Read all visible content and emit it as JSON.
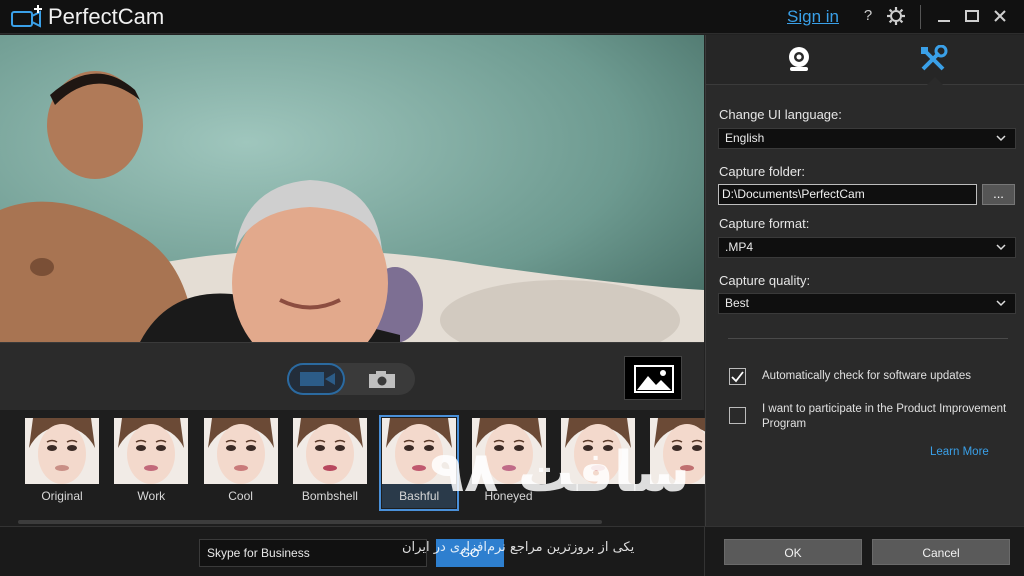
{
  "titlebar": {
    "app_name": "PerfectCam",
    "sign_in": "Sign in",
    "help_glyph": "?",
    "icons": [
      "add-camera-logo-icon",
      "help-icon",
      "gear-icon",
      "minimize-icon",
      "maximize-icon",
      "close-icon"
    ]
  },
  "capture": {
    "modes": [
      "video-camera-icon",
      "photo-camera-icon"
    ],
    "gallery_icon": "gallery-icon"
  },
  "effects": {
    "items": [
      {
        "label": "Original"
      },
      {
        "label": "Work"
      },
      {
        "label": "Cool"
      },
      {
        "label": "Bombshell"
      },
      {
        "label": "Bashful"
      },
      {
        "label": "Honeyed"
      },
      {
        "label": ""
      },
      {
        "label": ""
      }
    ],
    "selected": "Bashful"
  },
  "bottombar": {
    "app_select": "Skype for Business",
    "go": "GO",
    "ok": "OK",
    "cancel": "Cancel"
  },
  "settings": {
    "tabs": [
      "webcam-icon",
      "tools-icon"
    ],
    "active_tab": "tools-icon",
    "language_label": "Change UI language:",
    "language_value": "English",
    "folder_label": "Capture folder:",
    "folder_value": "D:\\Documents\\PerfectCam",
    "browse": "...",
    "format_label": "Capture format:",
    "format_value": ".MP4",
    "quality_label": "Capture quality:",
    "quality_value": "Best",
    "auto_update_label": "Automatically check for software updates",
    "auto_update_checked": true,
    "improvement_label": "I want to participate in the Product Improvement Program",
    "improvement_checked": false,
    "learn_more": "Learn More"
  },
  "watermark": {
    "big": "سافت ۹۸",
    "small": "یکی از بروزترین مراجع نرم‌افزاری در ایران"
  },
  "colors": {
    "accent": "#2e7fcf",
    "link": "#3aa0e8",
    "panel_bg": "#2a2a2a",
    "titlebar_bg": "#111111"
  }
}
